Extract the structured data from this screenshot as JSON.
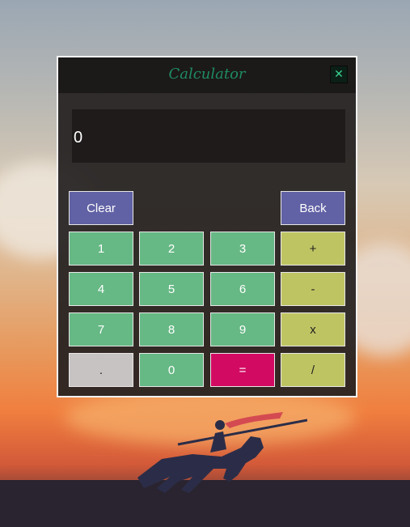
{
  "window": {
    "title": "Calculator",
    "close_symbol": "✕"
  },
  "display": {
    "value": "0"
  },
  "buttons": {
    "clear": "Clear",
    "back": "Back",
    "d1": "1",
    "d2": "2",
    "d3": "3",
    "d4": "4",
    "d5": "5",
    "d6": "6",
    "d7": "7",
    "d8": "8",
    "d9": "9",
    "d0": "0",
    "dot": ".",
    "equals": "=",
    "plus": "+",
    "minus": "-",
    "multiply": "x",
    "divide": "/"
  },
  "colors": {
    "title": "#1e8c61",
    "action": "#6161a5",
    "digit": "#66b884",
    "operator": "#bfc463",
    "equals": "#d20a62",
    "dot": "#c8c3c3"
  }
}
